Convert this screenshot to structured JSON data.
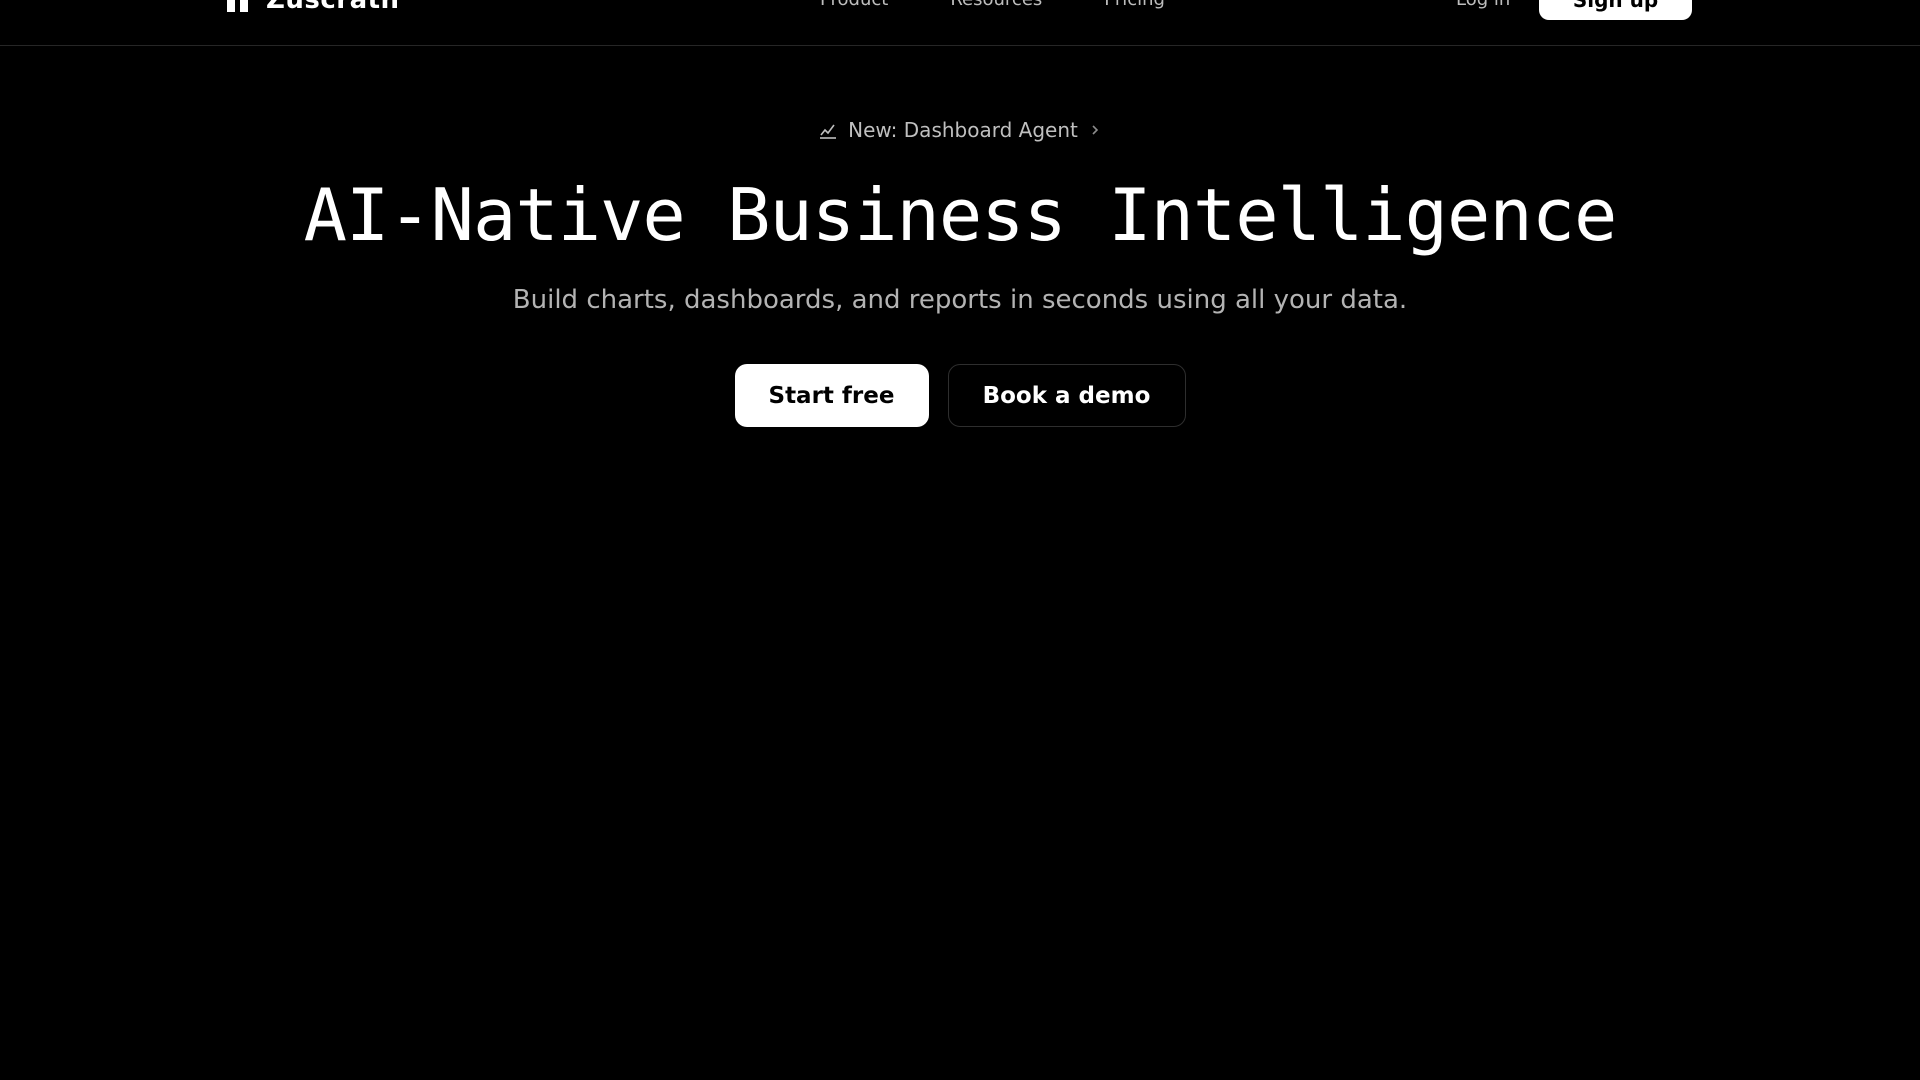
{
  "nav": {
    "brand_name": "Zuscrath",
    "links": [
      {
        "label": "Product"
      },
      {
        "label": "Resources"
      },
      {
        "label": "Pricing"
      }
    ],
    "login_label": "Log in",
    "signup_label": "Sign up"
  },
  "hero": {
    "announcement": {
      "icon": "line-chart-icon",
      "label": "New: Dashboard Agent",
      "arrow_icon": "chevron-right-icon"
    },
    "title": "AI-Native Business Intelligence",
    "subtitle": "Build charts, dashboards, and reports in seconds using all your data.",
    "primary_cta": "Start free",
    "secondary_cta": "Book a demo"
  },
  "colors": {
    "background": "#000000",
    "text": "#ffffff",
    "muted_text": "#b3b3b3",
    "primary_button_bg": "#ffffff",
    "primary_button_text": "#000000"
  }
}
